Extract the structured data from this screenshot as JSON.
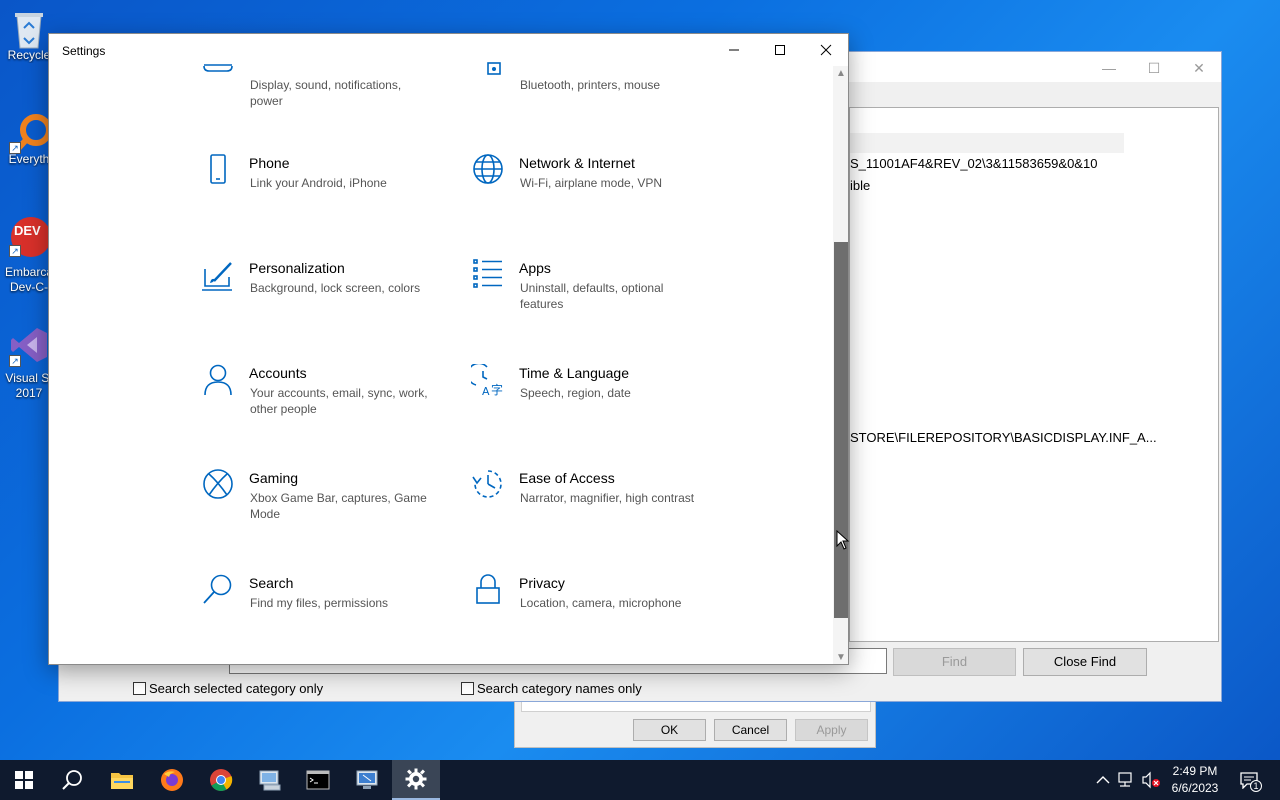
{
  "desktop": {
    "icons": [
      {
        "label": "Recycle",
        "icon": "recycle-bin-icon"
      },
      {
        "label": "Everyth",
        "icon": "everything-search-icon"
      },
      {
        "label": "Embarca",
        "label2": "Dev-C-",
        "icon": "dev-cpp-icon",
        "glyph_text": "DEV"
      },
      {
        "label": "Visual St",
        "label2": "2017",
        "icon": "visual-studio-icon"
      }
    ]
  },
  "background_window": {
    "panel_lines": [
      "S_11001AF4&REV_02\\3&11583659&0&10",
      "ible",
      "STORE\\FILEREPOSITORY\\BASICDISPLAY.INF_A..."
    ],
    "find_label": "Find",
    "close_find_label": "Close Find",
    "checkbox1": "Search selected category only",
    "checkbox2": "Search category names only"
  },
  "dialog": {
    "ok": "OK",
    "cancel": "Cancel",
    "apply": "Apply"
  },
  "settings": {
    "title": "Settings",
    "accent_color": "#0067c0",
    "tiles": [
      {
        "title": "",
        "subtitle": "Display, sound, notifications, power",
        "icon": "system-icon"
      },
      {
        "title": "",
        "subtitle": "Bluetooth, printers, mouse",
        "icon": "devices-icon"
      },
      {
        "title": "Phone",
        "subtitle": "Link your Android, iPhone",
        "icon": "phone-icon"
      },
      {
        "title": "Network & Internet",
        "subtitle": "Wi-Fi, airplane mode, VPN",
        "icon": "globe-icon"
      },
      {
        "title": "Personalization",
        "subtitle": "Background, lock screen, colors",
        "icon": "personalization-icon"
      },
      {
        "title": "Apps",
        "subtitle": "Uninstall, defaults, optional features",
        "icon": "apps-list-icon"
      },
      {
        "title": "Accounts",
        "subtitle": "Your accounts, email, sync, work, other people",
        "icon": "person-icon"
      },
      {
        "title": "Time & Language",
        "subtitle": "Speech, region, date",
        "icon": "time-language-icon"
      },
      {
        "title": "Gaming",
        "subtitle": "Xbox Game Bar, captures, Game Mode",
        "icon": "xbox-icon"
      },
      {
        "title": "Ease of Access",
        "subtitle": "Narrator, magnifier, high contrast",
        "icon": "ease-of-access-icon"
      },
      {
        "title": "Search",
        "subtitle": "Find my files, permissions",
        "icon": "search-icon"
      },
      {
        "title": "Privacy",
        "subtitle": "Location, camera, microphone",
        "icon": "lock-icon"
      }
    ]
  },
  "taskbar": {
    "time": "2:49 PM",
    "date": "6/6/2023",
    "notification_count": "1"
  }
}
